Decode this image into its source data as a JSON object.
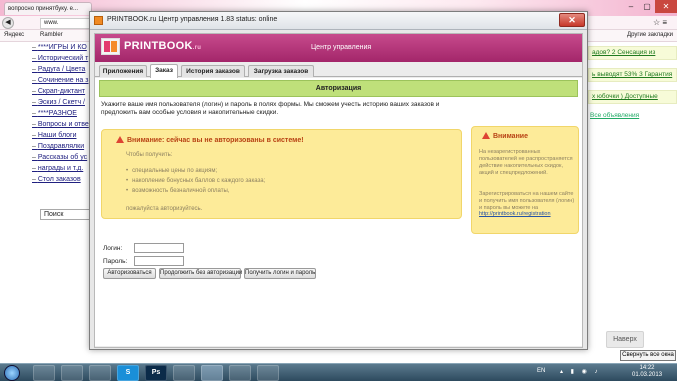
{
  "browser": {
    "tab_title": "вопросно принятбуку. е...",
    "address": "www.",
    "bookmarks": {
      "yandex": "Яндекс",
      "rambler": "Rambler",
      "other": "Другие закладки"
    }
  },
  "left_column": {
    "links": [
      "****ИГРЫ И КО",
      "Исторический т",
      "Радуга / Цвета",
      "Сочинение на з",
      "Скрап-диктант",
      "Эскиз / Скетч /",
      "****РАЗНОЕ",
      "Вопросы и отве",
      "Наши блоги",
      "Поздравлялки",
      "Рассказы об ус",
      "награды и т.д.",
      "Стол заказов"
    ],
    "search_value": "Поиск"
  },
  "right_column": {
    "ads": [
      "адов? 2 Сенсация из",
      "ь выводят 53% 3 Гарантия",
      "х юбочки ) Доступные"
    ],
    "all_ads": "Все объявления",
    "up_button": "Наверх",
    "tooltip": "Свернуть все окна"
  },
  "window": {
    "title": "PRINTBOOK.ru Центр управления 1.83 status: online",
    "close_label": "✕"
  },
  "app": {
    "logo": {
      "main": "PRINTBOOK",
      "suffix": ".ru"
    },
    "header_title": "Центр управления",
    "tabs": [
      "Приложения",
      "Заказ",
      "История заказов",
      "Загрузка заказов"
    ],
    "active_tab": "Заказ",
    "section_title": "Авторизация",
    "intro": "Укажите ваше имя пользователя (логин) и пароль в полях формы. Мы сможем учесть историю ваших заказов и предложить вам особые условия и накопительные скидки.",
    "warning_main": {
      "title": "Внимание: сейчас вы не авторизованы в системе!",
      "lead": "Чтобы получить:",
      "benefits": [
        "специальные цены по акциям;",
        "накопление бонусных баллов с каждого заказа;",
        "возможность безналичной оплаты,"
      ],
      "footer": "пожалуйста авторизуйтесь."
    },
    "warning_side": {
      "title": "Внимание",
      "text": "На незарегистрованных пользователей не распространяется действие накопительных скидок, акций и спецпредложений.",
      "text2": "Зарегистрироваться на нашем сайте и получить имя пользователя (логин) и пароль вы можете на",
      "link": "http://printbook.ru/registration"
    },
    "form": {
      "login_label": "Логин:",
      "password_label": "Пароль:",
      "login_value": "",
      "password_value": ""
    },
    "buttons": {
      "login": "Авторизоваться",
      "continue": "Продолжить без авторизации",
      "get_credentials": "Получить логин и пароль"
    }
  },
  "taskbar": {
    "items": [
      "",
      "",
      "",
      "S",
      "Ps",
      "",
      "",
      "",
      ""
    ],
    "lang": "EN",
    "time": "14:22",
    "date": "01.03.2013"
  }
}
